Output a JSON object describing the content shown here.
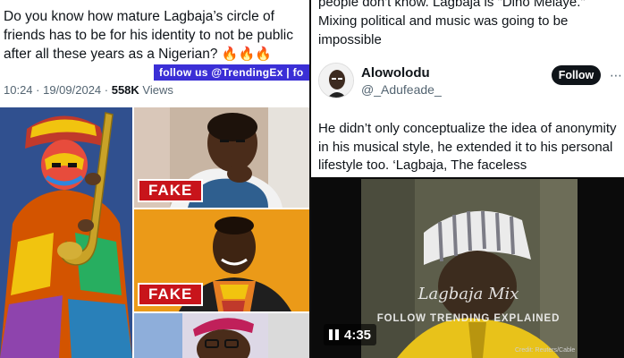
{
  "left_tweet": {
    "text": "Do you know how mature Lagbaja’s circle of friends has to be for his identity to not be public after all these years as a Nigerian?",
    "emojis": "🔥🔥🔥",
    "watermark": "follow us @TrendingEx | fo",
    "time": "10:24 · 19/09/2024 ·",
    "views_count": "558K",
    "views_label": "Views",
    "photo_labels": [
      "FAKE",
      "FAKE"
    ]
  },
  "right_tweet": {
    "prev_text": "people don't know. Lagbaja is \"Dino Melaye.\" Mixing political and music was going to be impossible",
    "display_name": "Alowolodu",
    "handle": "@_Adufeade_",
    "follow_label": "Follow",
    "more_icon": "⋯",
    "reply_text": "He didn’t only conceptualize the idea of anonymity in his musical style, he extended it to his personal lifestyle too. ‘Lagbaja, The faceless"
  },
  "video": {
    "watermark_title": "Lagbaja Mix",
    "watermark_sub": "FOLLOW TRENDING EXPLAINED",
    "time": "4:35",
    "credit": "Credit: Reuters/Cable"
  },
  "colors": {
    "fake_red": "#c8141b",
    "strip_blue": "#3b2fd6",
    "follow_btn": "#0f1419",
    "muted_text": "#536471"
  }
}
